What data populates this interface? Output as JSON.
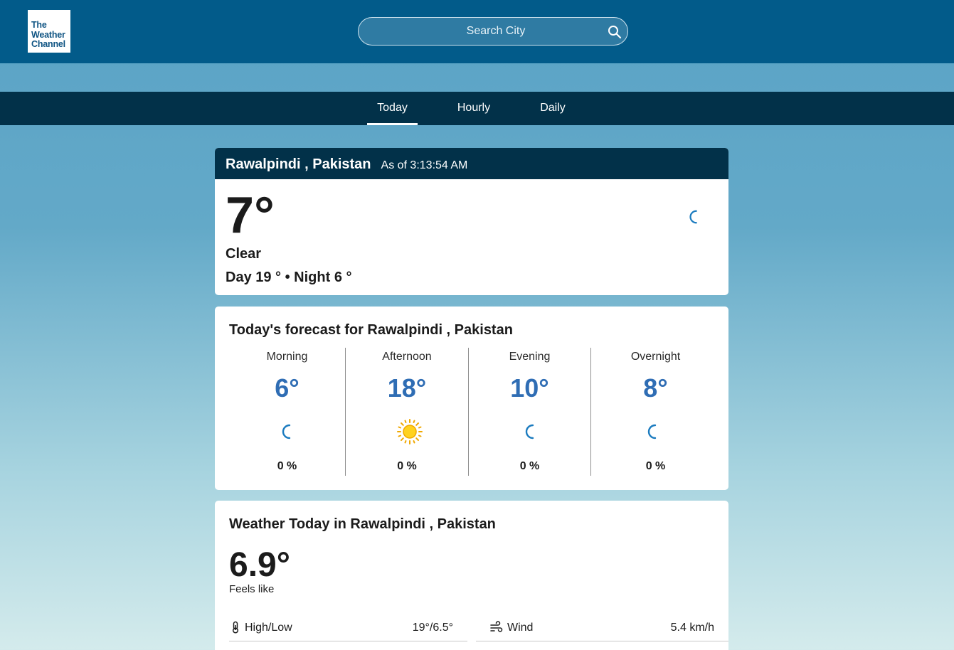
{
  "header": {
    "logo_text": [
      "The",
      "Weather",
      "Channel"
    ],
    "search_placeholder": "Search City",
    "brand_color": "#025b8a"
  },
  "tabs": [
    {
      "label": "Today",
      "active": true
    },
    {
      "label": "Hourly",
      "active": false
    },
    {
      "label": "Daily",
      "active": false
    }
  ],
  "current": {
    "location": "Rawalpindi , Pakistan",
    "as_of": "As of 3:13:54 AM",
    "temperature": "7°",
    "phrase": "Clear",
    "day_night": "Day 19 °  •  Night 6 °",
    "icon": "moon-icon"
  },
  "forecast": {
    "title": "Today's forecast for Rawalpindi , Pakistan",
    "periods": [
      {
        "label": "Morning",
        "temp": "6°",
        "icon": "moon-icon",
        "precip": "0 %"
      },
      {
        "label": "Afternoon",
        "temp": "18°",
        "icon": "sun-icon",
        "precip": "0 %"
      },
      {
        "label": "Evening",
        "temp": "10°",
        "icon": "moon-icon",
        "precip": "0 %"
      },
      {
        "label": "Overnight",
        "temp": "8°",
        "icon": "moon-icon",
        "precip": "0 %"
      }
    ]
  },
  "today_details": {
    "title": "Weather Today in Rawalpindi , Pakistan",
    "feels_like_temp": "6.9°",
    "feels_like_label": "Feels like",
    "rows": [
      {
        "label": "High/Low",
        "value": "19°/6.5°",
        "icon": "thermometer-icon"
      },
      {
        "label": "Wind",
        "value": "5.4 km/h",
        "icon": "wind-icon"
      }
    ]
  }
}
